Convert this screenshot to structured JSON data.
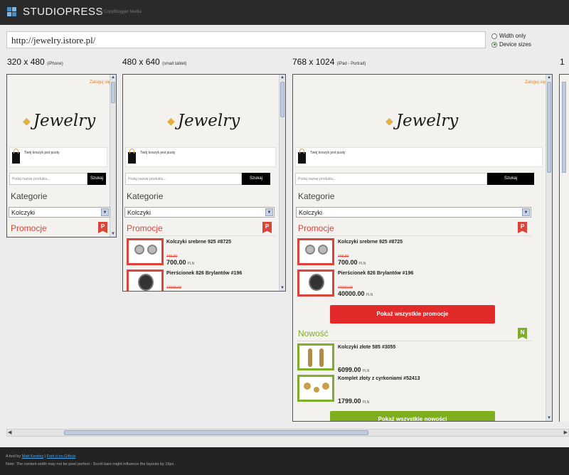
{
  "app": {
    "brand": "STUDIOPRESS",
    "byline": "by CopyBlogger Media",
    "accent": "#d9822b"
  },
  "url_input": {
    "value": "http://jewelry.istore.pl/"
  },
  "view_options": [
    {
      "label": "Width only",
      "selected": false
    },
    {
      "label": "Device sizes",
      "selected": true
    }
  ],
  "devices": [
    {
      "size": "320 x 480",
      "name": "(iPhone)"
    },
    {
      "size": "480 x 640",
      "name": "(small tablet)"
    },
    {
      "size": "768 x 1024",
      "name": "(iPad - Portrait)"
    },
    {
      "size": "1",
      "name": ""
    }
  ],
  "store": {
    "login": "Zaloguj się",
    "logo": "Jewelry",
    "cart_text": "Twój koszyk jest pusty",
    "search_placeholder": "Podaj nazwę produktu...",
    "search_button": "Szukaj",
    "categories_heading": "Kategorie",
    "category_selected": "Kolczyki",
    "promo_heading": "Promocje",
    "promo_badge": "P",
    "new_heading": "Nowość",
    "new_badge": "N",
    "promo_products": [
      {
        "name": "Kolczyki srebrne 925 #8725",
        "old_price": "749,00",
        "price": "700.00",
        "currency": "PLN"
      },
      {
        "name": "Pierścionek 826 Brylantów #196",
        "old_price": "47000,00",
        "price": "40000.00",
        "currency": "PLN"
      }
    ],
    "new_products": [
      {
        "name": "Kolczyki złote 585 #3055",
        "price": "6099.00",
        "currency": "PLN"
      },
      {
        "name": "Komplet złoty z cyrkoniami #52413",
        "price": "1799.00",
        "currency": "PLN"
      }
    ],
    "show_all_promo": "Pokaż wszystkie promocje",
    "show_all_new": "Pokaż wszystkie nowości"
  },
  "footer": {
    "prefix": "A tool by",
    "author_link": "Matt Kersley",
    "separator": "|",
    "fork_link": "Fork it on Github",
    "note": "Note: The content width may not be pixel perfect - Scroll bars might influence the layouts by 15px."
  }
}
